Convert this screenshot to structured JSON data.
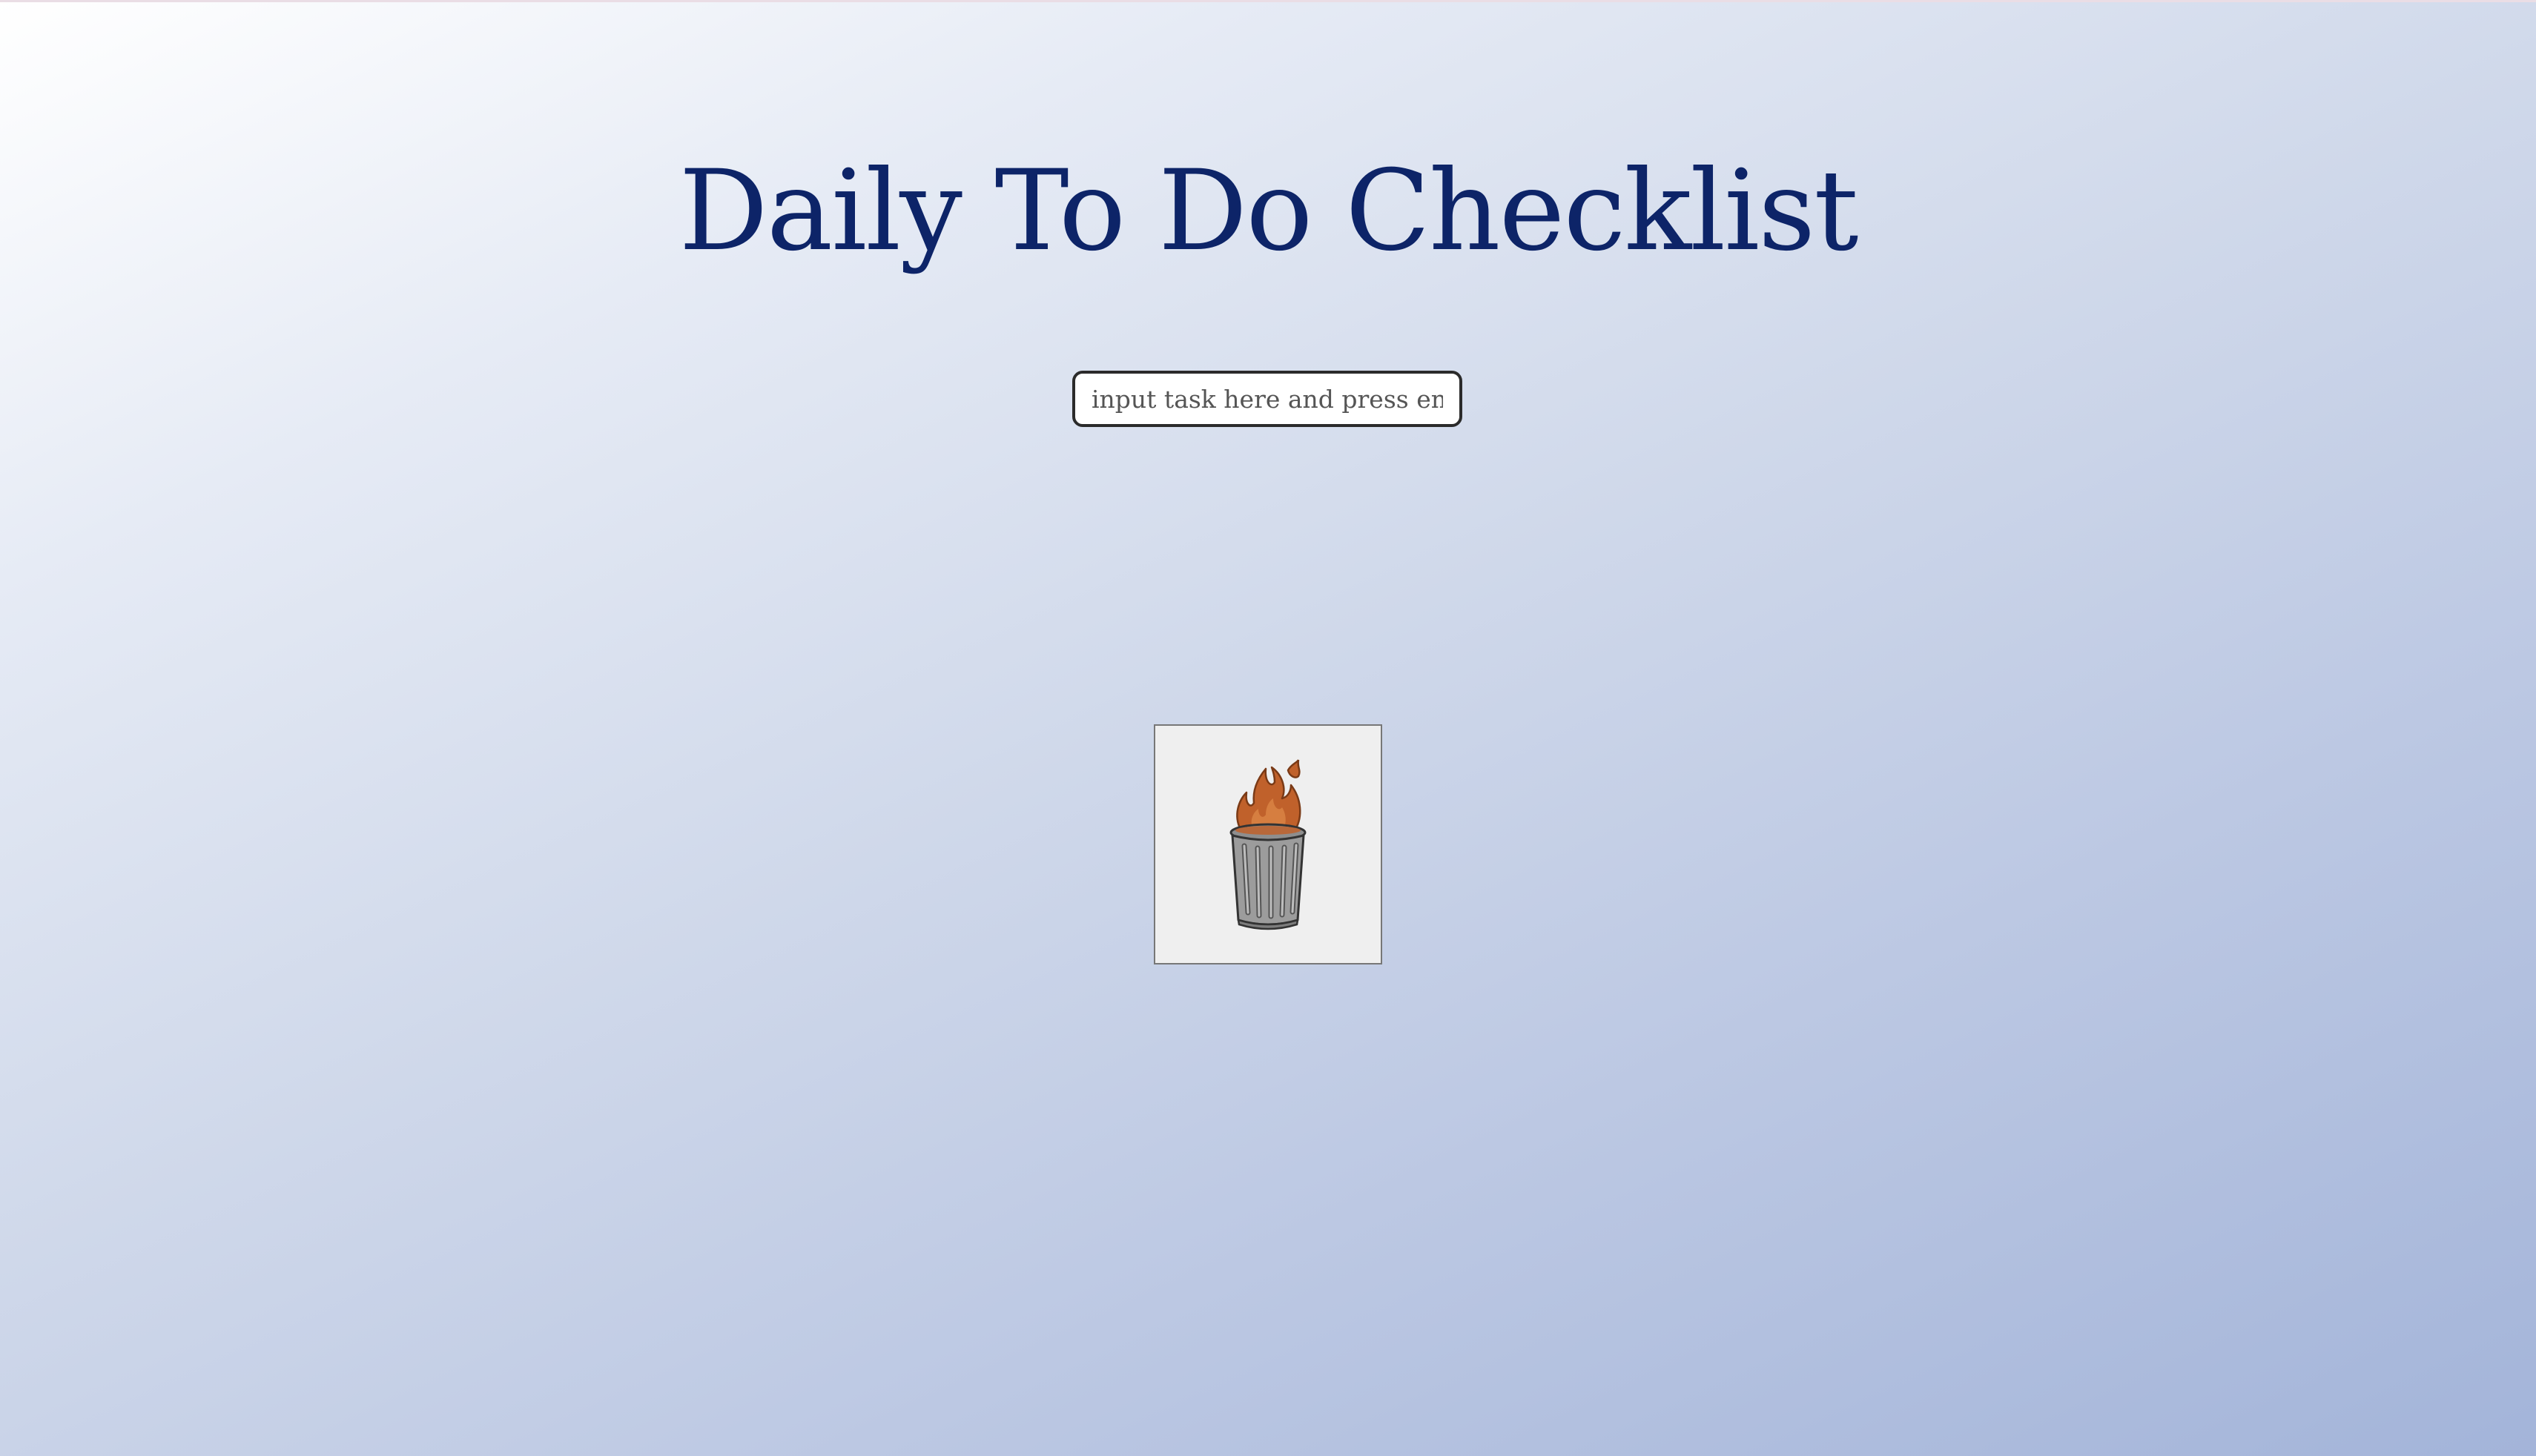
{
  "page": {
    "title": "Daily To Do Checklist"
  },
  "task_input": {
    "value": "",
    "placeholder": "input task here and press enter !!"
  },
  "clear_button": {
    "icon": "burning-trash-can-icon"
  },
  "colors": {
    "title": "#0d2468",
    "flame": "#c0612b",
    "can": "#9a9a9a",
    "background_start": "#ffffff",
    "background_end": "#a3b4d9"
  }
}
